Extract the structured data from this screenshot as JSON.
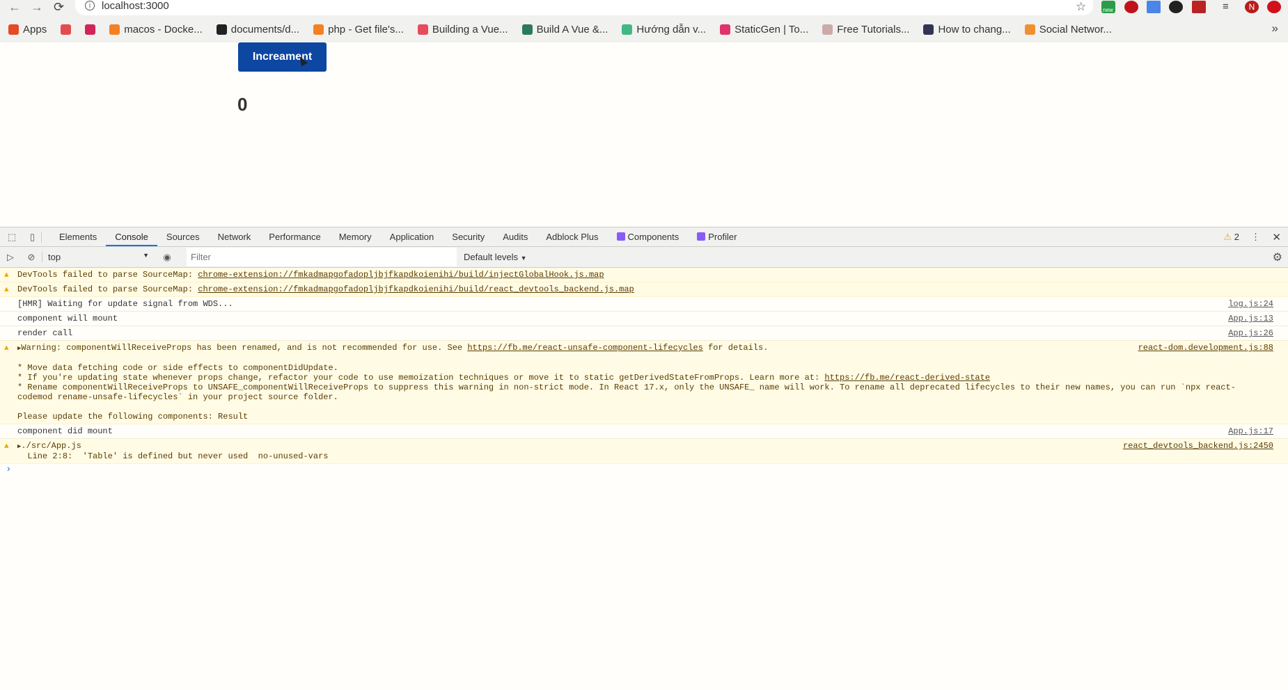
{
  "browser": {
    "url": "localhost:3000",
    "bookmarks": [
      {
        "label": "Apps",
        "color": "#e34c26"
      },
      {
        "label": "",
        "color": "#e34c4c"
      },
      {
        "label": "",
        "color": "#d3245a"
      },
      {
        "label": "macos - Docke...",
        "color": "#f48024"
      },
      {
        "label": "documents/d...",
        "color": "#222"
      },
      {
        "label": "php - Get file's...",
        "color": "#f48024"
      },
      {
        "label": "Building a Vue...",
        "color": "#e74c5c"
      },
      {
        "label": "Build A Vue &...",
        "color": "#2c7a5c"
      },
      {
        "label": "Hướng dẫn v...",
        "color": "#41b883"
      },
      {
        "label": "StaticGen | To...",
        "color": "#e0336b"
      },
      {
        "label": "Free Tutorials...",
        "color": "#caa"
      },
      {
        "label": "How to chang...",
        "color": "#335"
      },
      {
        "label": "Social Networ...",
        "color": "#f09030"
      }
    ],
    "ext_badge": "new",
    "profile_initial": "N"
  },
  "page": {
    "button_label": "Increament",
    "count": "0"
  },
  "devtools": {
    "tabs": [
      "Elements",
      "Console",
      "Sources",
      "Network",
      "Performance",
      "Memory",
      "Application",
      "Security",
      "Audits",
      "Adblock Plus",
      "Components",
      "Profiler"
    ],
    "warning_count": "2",
    "context": "top",
    "filter_placeholder": "Filter",
    "levels": "Default levels",
    "logs": [
      {
        "type": "warn",
        "text": "DevTools failed to parse SourceMap: ",
        "link": "chrome-extension://fmkadmapgofadopljbjfkapdkoienihi/build/injectGlobalHook.js.map",
        "src": ""
      },
      {
        "type": "warn",
        "text": "DevTools failed to parse SourceMap: ",
        "link": "chrome-extension://fmkadmapgofadopljbjfkapdkoienihi/build/react_devtools_backend.js.map",
        "src": ""
      },
      {
        "type": "log",
        "text": "[HMR] Waiting for update signal from WDS...",
        "src": "log.js:24"
      },
      {
        "type": "log",
        "text": "component will mount",
        "src": "App.js:13"
      },
      {
        "type": "log",
        "text": "render call",
        "src": "App.js:26"
      }
    ],
    "warning": {
      "pre": "Warning: componentWillReceiveProps has been renamed, and is not recommended for use. See ",
      "link1": "https://fb.me/react-unsafe-component-lifecycles",
      "post": " for details.",
      "b1": "* Move data fetching code or side effects to componentDidUpdate.",
      "b2": "* If you're updating state whenever props change, refactor your code to use memoization techniques or move it to static getDerivedStateFromProps. Learn more at: ",
      "link2": "https://fb.me/react-derived-state",
      "b3": "* Rename componentWillReceiveProps to UNSAFE_componentWillReceiveProps to suppress this warning in non-strict mode. In React 17.x, only the UNSAFE_ name will work. To rename all deprecated lifecycles to their new names, you can run `npx react-codemod rename-unsafe-lifecycles` in your project source folder.",
      "update": "Please update the following components: Result",
      "src": "react-dom.development.js:88"
    },
    "did_mount": {
      "text": "component did mount",
      "src": "App.js:17"
    },
    "lint": {
      "file": "./src/App.js",
      "line": "  Line 2:8:  'Table' is defined but never used  no-unused-vars",
      "src": "react_devtools_backend.js:2450"
    }
  }
}
